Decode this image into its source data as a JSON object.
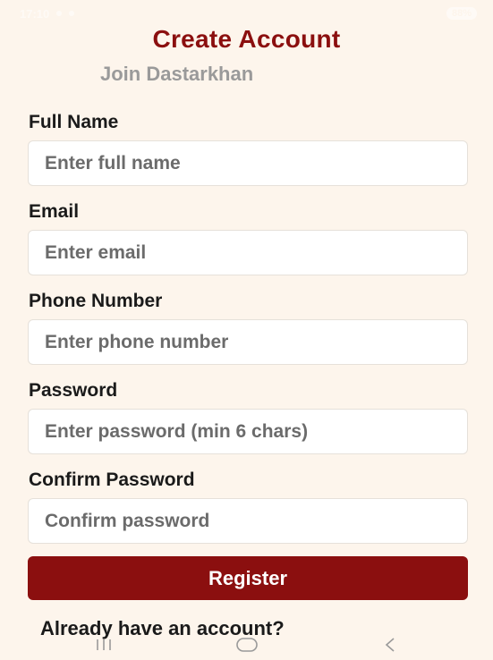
{
  "status_bar": {
    "time": "17:10",
    "indicators": "88%"
  },
  "header": {
    "title": "Create Account",
    "subtitle": "Join Dastarkhan"
  },
  "form": {
    "full_name": {
      "label": "Full Name",
      "placeholder": "Enter full name"
    },
    "email": {
      "label": "Email",
      "placeholder": "Enter email"
    },
    "phone": {
      "label": "Phone Number",
      "placeholder": "Enter phone number"
    },
    "password": {
      "label": "Password",
      "placeholder": "Enter password (min 6 chars)"
    },
    "confirm_password": {
      "label": "Confirm Password",
      "placeholder": "Confirm password"
    },
    "register_label": "Register"
  },
  "footer": {
    "login_prompt": "Already have an account?"
  },
  "nav": {
    "recents_icon": "recents-icon",
    "home_icon": "home-icon",
    "back_icon": "back-icon"
  },
  "colors": {
    "background": "#fdf5ec",
    "accent": "#8b0f0f",
    "subtitle": "#9a9a9a"
  }
}
